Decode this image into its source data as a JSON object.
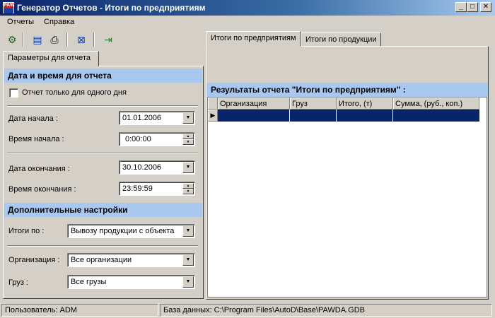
{
  "window": {
    "title": "Генератор Отчетов - Итоги по предприятиям",
    "icon_text": "PAW"
  },
  "menu": {
    "items": [
      "Отчеты",
      "Справка"
    ]
  },
  "toolbar": {
    "icons": [
      "run-report-icon",
      "form-icon",
      "print-icon",
      "excel-icon",
      "exit-icon"
    ]
  },
  "left": {
    "tab_label": "Параметры для отчета",
    "section_datetime": "Дата и время для отчета",
    "single_day_label": "Отчет только для одного дня",
    "start_date_label": "Дата начала :",
    "start_date_value": "01.01.2006",
    "start_time_label": "Время начала :",
    "start_time_value": "0:00:00",
    "end_date_label": "Дата окончания :",
    "end_date_value": "30.10.2006",
    "end_time_label": "Время окончания :",
    "end_time_value": "23:59:59",
    "section_extra": "Дополнительные настройки",
    "totals_by_label": "Итоги по :",
    "totals_by_value": "Вывозу продукции с объекта",
    "org_label": "Организация :",
    "org_value": "Все организации",
    "cargo_label": "Груз :",
    "cargo_value": "Все грузы"
  },
  "right": {
    "tabs": [
      "Итоги по предприятиям",
      "Итоги по продукции"
    ],
    "results_title": "Результаты отчета \"Итоги по предприятиям\" :",
    "columns": [
      "Организация",
      "Груз",
      "Итого, (т)",
      "Сумма, (руб., коп.)"
    ]
  },
  "status": {
    "user": "Пользователь: ADM",
    "db": "База данных: C:\\Program Files\\AutoD\\Base\\PAWDA.GDB"
  }
}
